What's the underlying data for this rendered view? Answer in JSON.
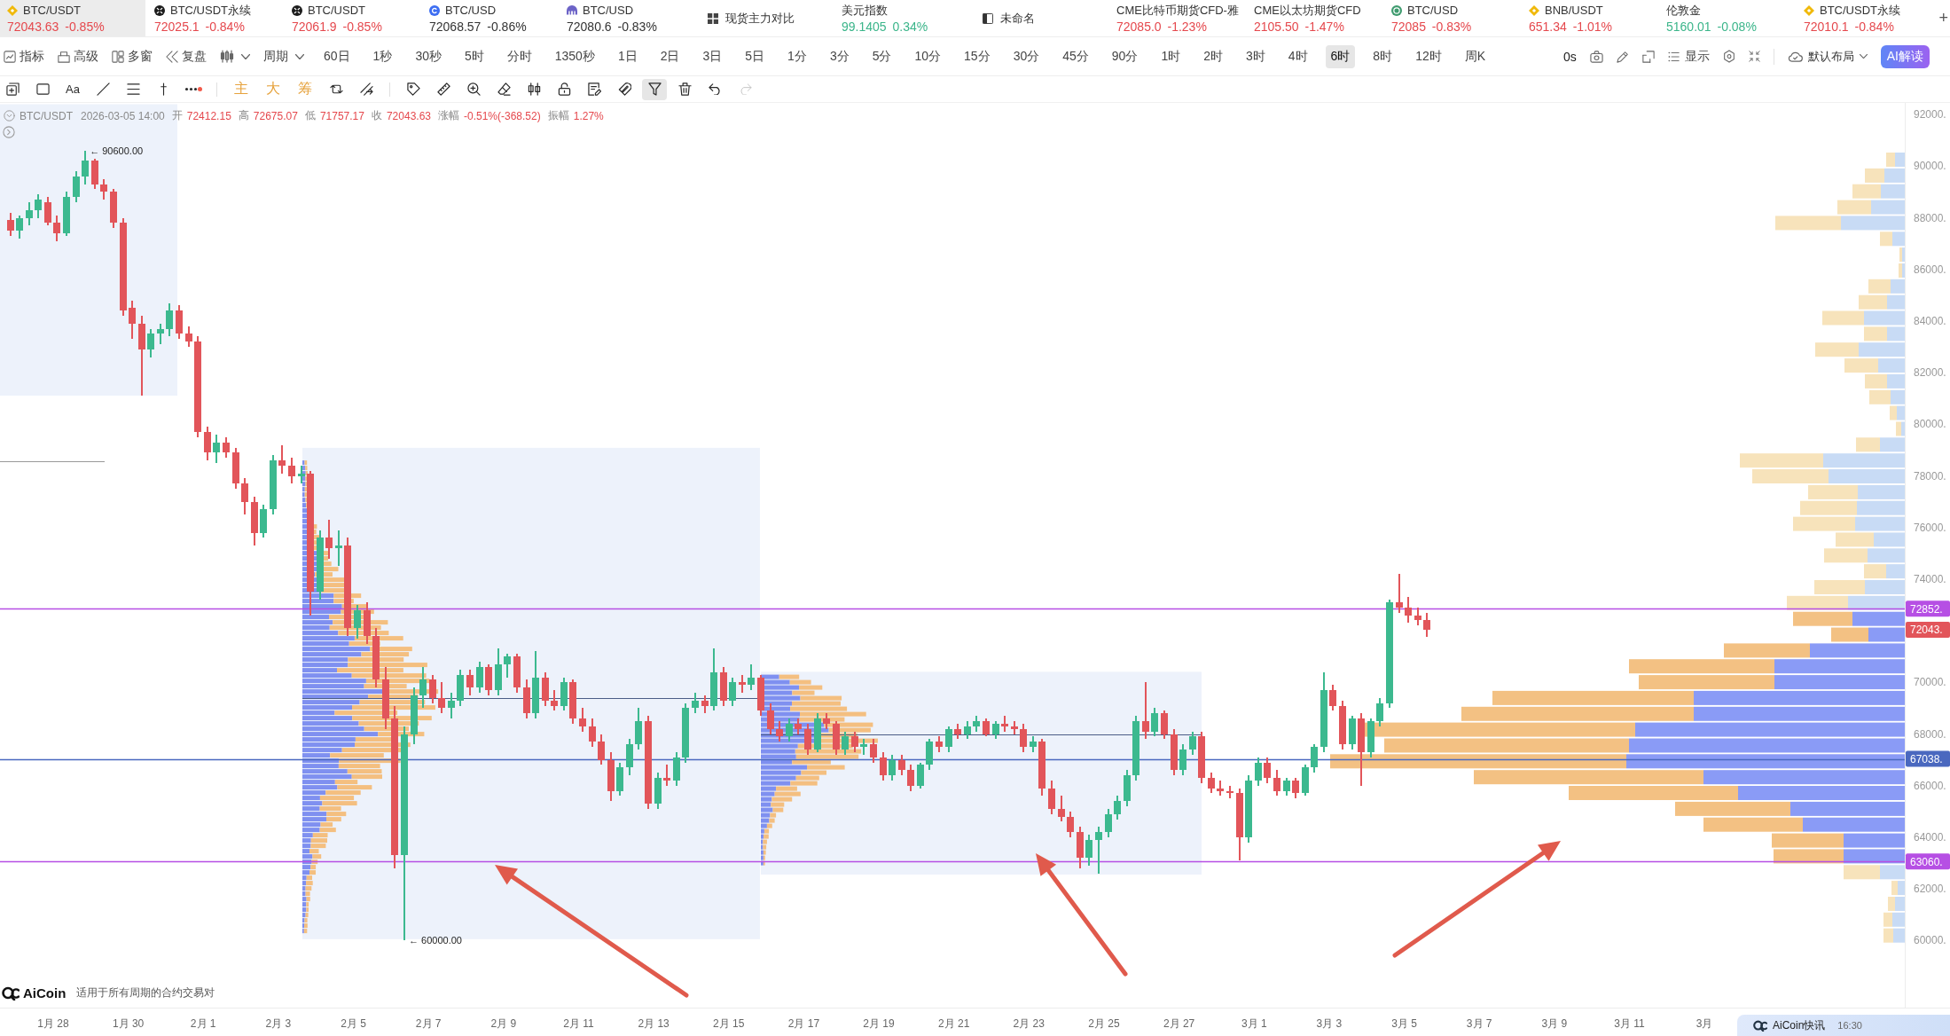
{
  "ticker_bar": {
    "items": [
      {
        "kind": "quote",
        "name": "BTC/USDT",
        "price": "72043.63",
        "change": "-0.85%",
        "color": "#e5484d",
        "selected": true
      },
      {
        "kind": "quote",
        "name": "BTC/USDT永续",
        "price": "72025.1",
        "change": "-0.84%",
        "color": "#e5484d",
        "selected": false
      },
      {
        "kind": "quote",
        "name": "BTC/USDT",
        "price": "72061.9",
        "change": "-0.85%",
        "color": "#e5484d",
        "selected": false
      },
      {
        "kind": "quote",
        "name": "BTC/USD",
        "price": "72068.57",
        "change": "-0.86%",
        "color": "#333333",
        "selected": false
      },
      {
        "kind": "quote",
        "name": "BTC/USD",
        "price": "72080.6",
        "change": "-0.83%",
        "color": "#333333",
        "selected": false
      },
      {
        "kind": "view",
        "name": "现货主力对比",
        "selected": false
      },
      {
        "kind": "quote",
        "name": "美元指数",
        "price": "99.1405",
        "change": "0.34%",
        "color": "#3bb58a",
        "selected": false
      },
      {
        "kind": "view",
        "name": "未命名",
        "selected": false
      },
      {
        "kind": "quote",
        "name": "CME比特币期货CFD-雅",
        "price": "72085.0",
        "change": "-1.23%",
        "color": "#e5484d",
        "selected": false
      },
      {
        "kind": "quote",
        "name": "CME以太坊期货CFD",
        "price": "2105.50",
        "change": "-1.47%",
        "color": "#e5484d",
        "selected": false
      },
      {
        "kind": "quote",
        "name": "BTC/USD",
        "price": "72085",
        "change": "-0.83%",
        "color": "#e5484d",
        "selected": false
      },
      {
        "kind": "quote",
        "name": "BNB/USDT",
        "price": "651.34",
        "change": "-1.01%",
        "color": "#e5484d",
        "selected": false
      },
      {
        "kind": "quote",
        "name": "伦敦金",
        "price": "5160.01",
        "change": "-0.08%",
        "color": "#3bb58a",
        "selected": false
      },
      {
        "kind": "quote",
        "name": "BTC/USDT永续",
        "price": "72010.1",
        "change": "-0.84%",
        "color": "#e5484d",
        "selected": false
      }
    ],
    "add_button": "+"
  },
  "toolbar": {
    "menus": [
      "指标",
      "高级",
      "多窗",
      "复盘"
    ],
    "period": "周期",
    "intervals": [
      {
        "label": "60日",
        "selected": false
      },
      {
        "label": "1秒",
        "selected": false
      },
      {
        "label": "30秒",
        "selected": false
      },
      {
        "label": "5时",
        "selected": false
      },
      {
        "label": "分时",
        "selected": false
      },
      {
        "label": "1350秒",
        "selected": false
      },
      {
        "label": "1日",
        "selected": false
      },
      {
        "label": "2日",
        "selected": false
      },
      {
        "label": "3日",
        "selected": false
      },
      {
        "label": "5日",
        "selected": false
      },
      {
        "label": "1分",
        "selected": false
      },
      {
        "label": "3分",
        "selected": false
      },
      {
        "label": "5分",
        "selected": false
      },
      {
        "label": "10分",
        "selected": false
      },
      {
        "label": "15分",
        "selected": false
      },
      {
        "label": "30分",
        "selected": false
      },
      {
        "label": "45分",
        "selected": false
      },
      {
        "label": "90分",
        "selected": false
      },
      {
        "label": "1时",
        "selected": false
      },
      {
        "label": "2时",
        "selected": false
      },
      {
        "label": "3时",
        "selected": false
      },
      {
        "label": "4时",
        "selected": false
      },
      {
        "label": "6时",
        "selected": true
      },
      {
        "label": "8时",
        "selected": false
      },
      {
        "label": "12时",
        "selected": false
      },
      {
        "label": "周K",
        "selected": false
      }
    ],
    "countdown": "0s",
    "display": "显示",
    "layout": "默认布局",
    "ai_button": "AI解读"
  },
  "drawing_toolbar": {
    "shapes": [
      {
        "selected": false
      },
      {
        "selected": false
      },
      {
        "label": "Aa",
        "selected": false
      },
      {
        "selected": false
      },
      {
        "selected": false
      },
      {
        "selected": false
      },
      {
        "selected": false
      }
    ],
    "indicators": [
      {
        "label": "主",
        "selected": false
      },
      {
        "label": "大",
        "selected": false
      },
      {
        "label": "筹",
        "selected": false
      },
      {
        "selected": false
      },
      {
        "selected": false
      }
    ],
    "tools": [
      {
        "selected": false,
        "disabled": false
      },
      {
        "selected": false,
        "disabled": false
      },
      {
        "selected": false,
        "disabled": false
      },
      {
        "selected": false,
        "disabled": false
      },
      {
        "selected": false,
        "disabled": false
      },
      {
        "selected": false,
        "disabled": false
      },
      {
        "selected": false,
        "disabled": false
      },
      {
        "selected": false,
        "disabled": false
      },
      {
        "selected": true,
        "disabled": false
      },
      {
        "selected": false,
        "disabled": false
      },
      {
        "selected": false,
        "disabled": false
      },
      {
        "selected": false,
        "disabled": true
      }
    ]
  },
  "info": {
    "symbol": "BTC/USDT",
    "time": "2026-03-05 14:00",
    "fields": [
      {
        "label": "开",
        "value": "72412.15"
      },
      {
        "label": "高",
        "value": "72675.07"
      },
      {
        "label": "低",
        "value": "71757.17"
      },
      {
        "label": "收",
        "value": "72043.63"
      },
      {
        "label": "涨幅",
        "value": "-0.51%(-368.52)"
      },
      {
        "label": "振幅",
        "value": "1.27%"
      }
    ]
  },
  "chart": {
    "chart_data": [
      {
        "type": "candlestick",
        "x": [
          "2026-01-26T20:00",
          "2026-01-27T02:00",
          "2026-01-27T08:00",
          "2026-01-27T14:00",
          "2026-01-27T20:00",
          "2026-01-28T02:00",
          "2026-01-28T08:00",
          "2026-01-28T14:00",
          "2026-01-28T20:00",
          "2026-01-29T02:00",
          "2026-01-29T08:00",
          "2026-01-29T14:00",
          "2026-01-29T20:00",
          "2026-01-30T02:00",
          "2026-01-30T08:00",
          "2026-01-30T14:00",
          "2026-01-30T20:00",
          "2026-01-31T02:00",
          "2026-01-31T08:00",
          "2026-01-31T14:00",
          "2026-01-31T20:00",
          "2026-02-01T02:00",
          "2026-02-01T08:00",
          "2026-02-01T14:00",
          "2026-02-01T20:00",
          "2026-02-02T02:00",
          "2026-02-02T08:00",
          "2026-02-02T14:00",
          "2026-02-02T20:00",
          "2026-02-03T02:00",
          "2026-02-03T08:00",
          "2026-02-03T14:00",
          "2026-02-03T20:00",
          "2026-02-04T02:00",
          "2026-02-04T08:00",
          "2026-02-04T14:00",
          "2026-02-04T20:00",
          "2026-02-05T02:00",
          "2026-02-05T08:00",
          "2026-02-05T14:00",
          "2026-02-05T20:00",
          "2026-02-06T02:00",
          "2026-02-06T08:00",
          "2026-02-06T14:00",
          "2026-02-06T20:00",
          "2026-02-07T02:00",
          "2026-02-07T08:00",
          "2026-02-07T14:00",
          "2026-02-07T20:00",
          "2026-02-08T02:00",
          "2026-02-08T08:00",
          "2026-02-08T14:00",
          "2026-02-08T20:00",
          "2026-02-09T02:00",
          "2026-02-09T08:00",
          "2026-02-09T14:00",
          "2026-02-09T20:00",
          "2026-02-10T02:00",
          "2026-02-10T08:00",
          "2026-02-10T14:00",
          "2026-02-10T20:00",
          "2026-02-11T02:00",
          "2026-02-11T08:00",
          "2026-02-11T14:00",
          "2026-02-11T20:00",
          "2026-02-12T02:00",
          "2026-02-12T08:00",
          "2026-02-12T14:00",
          "2026-02-12T20:00",
          "2026-02-13T02:00",
          "2026-02-13T08:00",
          "2026-02-13T14:00",
          "2026-02-13T20:00",
          "2026-02-14T02:00",
          "2026-02-14T08:00",
          "2026-02-14T14:00",
          "2026-02-14T20:00",
          "2026-02-15T02:00",
          "2026-02-15T08:00",
          "2026-02-15T14:00",
          "2026-02-15T20:00",
          "2026-02-16T02:00",
          "2026-02-16T08:00",
          "2026-02-16T14:00",
          "2026-02-16T20:00",
          "2026-02-17T02:00",
          "2026-02-17T08:00",
          "2026-02-17T14:00",
          "2026-02-17T20:00",
          "2026-02-18T02:00",
          "2026-02-18T08:00",
          "2026-02-18T14:00",
          "2026-02-18T20:00",
          "2026-02-19T02:00",
          "2026-02-19T08:00",
          "2026-02-19T14:00",
          "2026-02-19T20:00",
          "2026-02-20T02:00",
          "2026-02-20T08:00",
          "2026-02-20T14:00",
          "2026-02-20T20:00",
          "2026-02-21T02:00",
          "2026-02-21T08:00",
          "2026-02-21T14:00",
          "2026-02-21T20:00",
          "2026-02-22T02:00",
          "2026-02-22T08:00",
          "2026-02-22T14:00",
          "2026-02-22T20:00",
          "2026-02-23T02:00",
          "2026-02-23T08:00",
          "2026-02-23T14:00",
          "2026-02-23T20:00",
          "2026-02-24T02:00",
          "2026-02-24T08:00",
          "2026-02-24T14:00",
          "2026-02-24T20:00",
          "2026-02-25T02:00",
          "2026-02-25T08:00",
          "2026-02-25T14:00",
          "2026-02-25T20:00",
          "2026-02-26T02:00",
          "2026-02-26T08:00",
          "2026-02-26T14:00",
          "2026-02-26T20:00",
          "2026-02-27T02:00",
          "2026-02-27T08:00",
          "2026-02-27T14:00",
          "2026-02-27T20:00",
          "2026-02-28T02:00",
          "2026-02-28T08:00",
          "2026-02-28T14:00",
          "2026-02-28T20:00",
          "2026-03-01T02:00",
          "2026-03-01T08:00",
          "2026-03-01T14:00",
          "2026-03-01T20:00",
          "2026-03-02T02:00",
          "2026-03-02T08:00",
          "2026-03-02T14:00",
          "2026-03-02T20:00",
          "2026-03-03T02:00",
          "2026-03-03T08:00",
          "2026-03-03T14:00",
          "2026-03-03T20:00",
          "2026-03-04T02:00",
          "2026-03-04T08:00",
          "2026-03-04T14:00",
          "2026-03-04T20:00",
          "2026-03-05T02:00",
          "2026-03-05T08:00",
          "2026-03-05T14:00"
        ],
        "ohlc": [
          [
            87900,
            88200,
            87300,
            87500
          ],
          [
            87500,
            88100,
            87200,
            88000
          ],
          [
            88000,
            88600,
            87700,
            88300
          ],
          [
            88300,
            88900,
            88000,
            88700
          ],
          [
            88600,
            88800,
            87700,
            87800
          ],
          [
            87800,
            88100,
            87100,
            87400
          ],
          [
            87400,
            89000,
            87300,
            88800
          ],
          [
            88800,
            89800,
            88600,
            89600
          ],
          [
            89600,
            90600,
            89300,
            90200
          ],
          [
            90200,
            90300,
            89100,
            89300
          ],
          [
            89300,
            89500,
            88700,
            89000
          ],
          [
            89000,
            89100,
            87600,
            87800
          ],
          [
            87800,
            88000,
            84200,
            84400
          ],
          [
            84500,
            84800,
            83300,
            83900
          ],
          [
            83900,
            84200,
            81100,
            82900
          ],
          [
            82900,
            83700,
            82600,
            83500
          ],
          [
            83500,
            83900,
            83100,
            83700
          ],
          [
            83700,
            84700,
            83400,
            84400
          ],
          [
            84400,
            84600,
            83300,
            83500
          ],
          [
            83500,
            83800,
            83000,
            83200
          ],
          [
            83200,
            83400,
            79500,
            79700
          ],
          [
            79700,
            79900,
            78600,
            78900
          ],
          [
            78900,
            79600,
            78500,
            79300
          ],
          [
            79300,
            79500,
            78700,
            78900
          ],
          [
            78900,
            79100,
            77500,
            77700
          ],
          [
            77700,
            77900,
            76500,
            77000
          ],
          [
            77000,
            77200,
            75300,
            75800
          ],
          [
            75800,
            76900,
            75600,
            76700
          ],
          [
            76700,
            78800,
            76500,
            78600
          ],
          [
            78600,
            79200,
            78100,
            78400
          ],
          [
            78400,
            78700,
            77700,
            78000
          ],
          [
            78000,
            78400,
            77700,
            78100
          ],
          [
            78100,
            78200,
            72600,
            73500
          ],
          [
            73500,
            75900,
            73200,
            75600
          ],
          [
            75600,
            76300,
            74800,
            75200
          ],
          [
            75200,
            75900,
            74500,
            75300
          ],
          [
            75300,
            75600,
            71800,
            72100
          ],
          [
            72100,
            73000,
            71700,
            72800
          ],
          [
            72800,
            73100,
            71500,
            71800
          ],
          [
            71800,
            72100,
            69800,
            70100
          ],
          [
            70100,
            70600,
            68200,
            68600
          ],
          [
            68600,
            69100,
            62800,
            63300
          ],
          [
            63300,
            68300,
            60000,
            68000
          ],
          [
            68000,
            69800,
            67600,
            69500
          ],
          [
            69500,
            70600,
            69000,
            70100
          ],
          [
            70100,
            70300,
            69200,
            69400
          ],
          [
            69400,
            70000,
            68800,
            69000
          ],
          [
            69000,
            69600,
            68600,
            69300
          ],
          [
            69300,
            70500,
            69100,
            70300
          ],
          [
            70300,
            70500,
            69500,
            69800
          ],
          [
            69800,
            70800,
            69600,
            70600
          ],
          [
            70600,
            70700,
            69500,
            69700
          ],
          [
            69700,
            71300,
            69500,
            70700
          ],
          [
            70700,
            71100,
            70200,
            71000
          ],
          [
            71000,
            71100,
            69600,
            69800
          ],
          [
            69800,
            70100,
            68600,
            68800
          ],
          [
            68800,
            71200,
            68600,
            70200
          ],
          [
            70200,
            70400,
            69100,
            69300
          ],
          [
            69300,
            69700,
            68900,
            69100
          ],
          [
            69100,
            70200,
            68900,
            70000
          ],
          [
            70000,
            70100,
            68400,
            68600
          ],
          [
            68600,
            69000,
            68100,
            68300
          ],
          [
            68300,
            68600,
            67500,
            67700
          ],
          [
            67700,
            68000,
            66800,
            67000
          ],
          [
            67000,
            67300,
            65400,
            65800
          ],
          [
            65800,
            66900,
            65600,
            66700
          ],
          [
            66700,
            67800,
            66400,
            67600
          ],
          [
            67600,
            69000,
            67400,
            68500
          ],
          [
            68500,
            68700,
            65100,
            65300
          ],
          [
            65300,
            66500,
            65100,
            66300
          ],
          [
            66300,
            66800,
            66000,
            66200
          ],
          [
            66200,
            67300,
            66000,
            67100
          ],
          [
            67100,
            69200,
            66900,
            69000
          ],
          [
            69000,
            69600,
            68800,
            69300
          ],
          [
            69300,
            69500,
            68800,
            69100
          ],
          [
            69100,
            71300,
            68900,
            70400
          ],
          [
            70400,
            70600,
            69100,
            69300
          ],
          [
            69300,
            70200,
            69100,
            70000
          ],
          [
            70000,
            70300,
            69600,
            69900
          ],
          [
            69900,
            70700,
            69700,
            70200
          ],
          [
            70200,
            70300,
            68700,
            68900
          ],
          [
            68900,
            69200,
            68000,
            68200
          ],
          [
            68200,
            68500,
            67700,
            67900
          ],
          [
            67900,
            68600,
            67700,
            68400
          ],
          [
            68400,
            68600,
            68000,
            68200
          ],
          [
            68200,
            68400,
            67200,
            67400
          ],
          [
            67400,
            68800,
            67300,
            68600
          ],
          [
            68600,
            68800,
            68200,
            68400
          ],
          [
            68400,
            68500,
            67200,
            67400
          ],
          [
            67400,
            68100,
            67200,
            67900
          ],
          [
            67900,
            68100,
            67300,
            67500
          ],
          [
            67500,
            67800,
            67200,
            67600
          ],
          [
            67600,
            67800,
            66900,
            67100
          ],
          [
            67100,
            67300,
            66200,
            66400
          ],
          [
            66400,
            67200,
            66200,
            67000
          ],
          [
            67000,
            67200,
            66400,
            66600
          ],
          [
            66600,
            66800,
            65800,
            66000
          ],
          [
            66000,
            66900,
            65900,
            66800
          ],
          [
            66800,
            67800,
            66600,
            67700
          ],
          [
            67700,
            67900,
            67300,
            67500
          ],
          [
            67500,
            68300,
            67300,
            68200
          ],
          [
            68200,
            68400,
            67800,
            68000
          ],
          [
            68000,
            68500,
            67800,
            68300
          ],
          [
            68300,
            68700,
            68100,
            68500
          ],
          [
            68500,
            68600,
            67900,
            68000
          ],
          [
            68000,
            68500,
            67800,
            68400
          ],
          [
            68400,
            68700,
            68100,
            68300
          ],
          [
            68300,
            68500,
            68000,
            68200
          ],
          [
            68200,
            68400,
            67300,
            67500
          ],
          [
            67500,
            67900,
            67300,
            67700
          ],
          [
            67700,
            67800,
            65600,
            65900
          ],
          [
            65900,
            66200,
            64900,
            65100
          ],
          [
            65100,
            65600,
            64600,
            64800
          ],
          [
            64800,
            65000,
            64000,
            64200
          ],
          [
            64200,
            64400,
            62800,
            63200
          ],
          [
            63200,
            64100,
            62900,
            63900
          ],
          [
            63900,
            64400,
            62600,
            64200
          ],
          [
            64200,
            65100,
            64000,
            64900
          ],
          [
            64900,
            65600,
            64700,
            65400
          ],
          [
            65400,
            66600,
            65200,
            66400
          ],
          [
            66400,
            68700,
            66200,
            68500
          ],
          [
            68500,
            70000,
            67800,
            68100
          ],
          [
            68100,
            69000,
            67900,
            68800
          ],
          [
            68800,
            68900,
            67800,
            68000
          ],
          [
            68000,
            68200,
            66400,
            66600
          ],
          [
            66600,
            67600,
            66400,
            67400
          ],
          [
            67400,
            68100,
            67200,
            67900
          ],
          [
            67900,
            68100,
            66100,
            66300
          ],
          [
            66300,
            66500,
            65700,
            65900
          ],
          [
            65900,
            66200,
            65600,
            65800
          ],
          [
            65800,
            66000,
            65500,
            65700
          ],
          [
            65700,
            65900,
            63100,
            64000
          ],
          [
            64000,
            66400,
            63800,
            66200
          ],
          [
            66200,
            67100,
            66000,
            66900
          ],
          [
            66900,
            67100,
            66100,
            66300
          ],
          [
            66300,
            66600,
            65600,
            65800
          ],
          [
            65800,
            66300,
            65600,
            66200
          ],
          [
            66200,
            66300,
            65500,
            65700
          ],
          [
            65700,
            66800,
            65600,
            66700
          ],
          [
            66700,
            67600,
            66500,
            67500
          ],
          [
            67500,
            70400,
            67300,
            69700
          ],
          [
            69700,
            69900,
            68900,
            69100
          ],
          [
            69100,
            69300,
            67400,
            67600
          ],
          [
            67600,
            68700,
            67400,
            68600
          ],
          [
            68600,
            68800,
            66000,
            67300
          ],
          [
            67300,
            68600,
            67100,
            68500
          ],
          [
            68500,
            69400,
            68300,
            69200
          ],
          [
            69200,
            73200,
            69000,
            73100
          ],
          [
            73100,
            74200,
            72700,
            72900
          ],
          [
            72900,
            73300,
            72300,
            72600
          ],
          [
            72600,
            72900,
            72200,
            72400
          ],
          [
            72412.15,
            72675.07,
            71757.17,
            72043.63
          ]
        ],
        "xlim": [
          "2026-01-26T14:00",
          "2026-03-19T13:00"
        ],
        "ylim": [
          57400,
          92450
        ],
        "xticks": [
          {
            "value": "2026-01-28",
            "label": "1月 28"
          },
          {
            "value": "2026-01-30",
            "label": "1月 30"
          },
          {
            "value": "2026-02-01",
            "label": "2月 1"
          },
          {
            "value": "2026-02-03",
            "label": "2月 3"
          },
          {
            "value": "2026-02-05",
            "label": "2月 5"
          },
          {
            "value": "2026-02-07",
            "label": "2月 7"
          },
          {
            "value": "2026-02-09",
            "label": "2月 9"
          },
          {
            "value": "2026-02-11",
            "label": "2月 11"
          },
          {
            "value": "2026-02-13",
            "label": "2月 13"
          },
          {
            "value": "2026-02-15",
            "label": "2月 15"
          },
          {
            "value": "2026-02-17",
            "label": "2月 17"
          },
          {
            "value": "2026-02-19",
            "label": "2月 19"
          },
          {
            "value": "2026-02-21",
            "label": "2月 21"
          },
          {
            "value": "2026-02-23",
            "label": "2月 23"
          },
          {
            "value": "2026-02-25",
            "label": "2月 25"
          },
          {
            "value": "2026-02-27",
            "label": "2月 27"
          },
          {
            "value": "2026-03-01",
            "label": "3月 1"
          },
          {
            "value": "2026-03-03",
            "label": "3月 3"
          },
          {
            "value": "2026-03-05",
            "label": "3月 5"
          },
          {
            "value": "2026-03-07",
            "label": "3月 7"
          },
          {
            "value": "2026-03-09",
            "label": "3月 9"
          },
          {
            "value": "2026-03-11",
            "label": "3月 11"
          },
          {
            "value": "2026-03-13",
            "label": "3月"
          }
        ],
        "yticks": [
          {
            "value": 92000,
            "label": "92000."
          },
          {
            "value": 90000,
            "label": "90000."
          },
          {
            "value": 88000,
            "label": "88000."
          },
          {
            "value": 86000,
            "label": "86000."
          },
          {
            "value": 84000,
            "label": "84000."
          },
          {
            "value": 82000,
            "label": "82000."
          },
          {
            "value": 80000,
            "label": "80000."
          },
          {
            "value": 78000,
            "label": "78000."
          },
          {
            "value": 76000,
            "label": "76000."
          },
          {
            "value": 74000,
            "label": "74000."
          },
          {
            "value": 70000,
            "label": "70000."
          },
          {
            "value": 68000,
            "label": "68000."
          },
          {
            "value": 66000,
            "label": "66000."
          },
          {
            "value": 64000,
            "label": "64000."
          },
          {
            "value": 62000,
            "label": "62000."
          },
          {
            "value": 60000,
            "label": "60000."
          }
        ],
        "ref_lines": [
          {
            "axis": "y",
            "value": 72852,
            "label": "72852.",
            "color": "#b64fe4"
          },
          {
            "axis": "y",
            "value": 67038,
            "label": "67038.",
            "color": "#4a68bf"
          },
          {
            "axis": "y",
            "value": 63060,
            "label": "63060.",
            "color": "#b64fe4"
          }
        ],
        "annotations": [
          "← 90600.00",
          "← 60000.00"
        ]
      }
    ],
    "last_price_tag": "72043.",
    "brand": "AiCoin",
    "note": "适用于所有周期的合约交易对"
  },
  "news_popup": {
    "title": "AiCoin快讯",
    "time": "16:30"
  }
}
